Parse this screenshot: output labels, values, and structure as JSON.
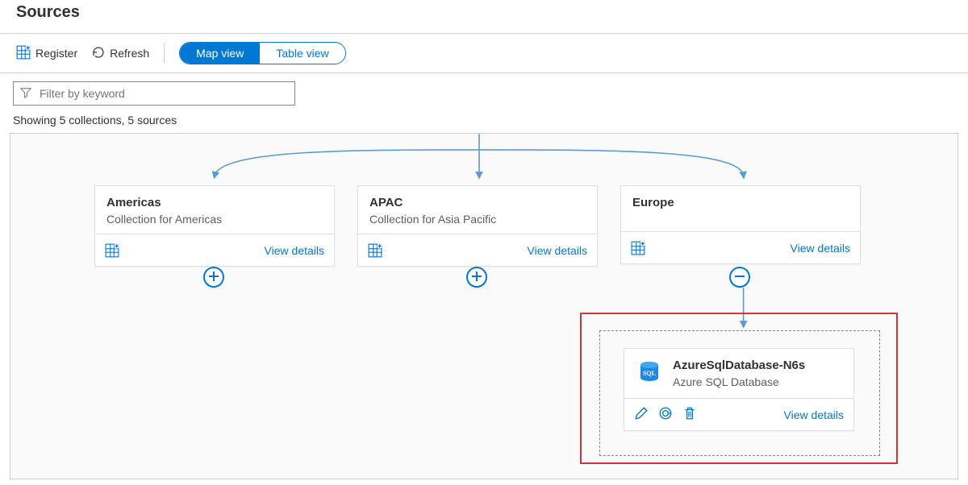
{
  "title": "Sources",
  "toolbar": {
    "register_label": "Register",
    "refresh_label": "Refresh",
    "map_view_label": "Map view",
    "table_view_label": "Table view"
  },
  "filter": {
    "placeholder": "Filter by keyword"
  },
  "count_text": "Showing 5 collections, 5 sources",
  "cards": [
    {
      "title": "Americas",
      "subtitle": "Collection for Americas",
      "link": "View details"
    },
    {
      "title": "APAC",
      "subtitle": "Collection for Asia Pacific",
      "link": "View details"
    },
    {
      "title": "Europe",
      "subtitle": "",
      "link": "View details"
    }
  ],
  "source": {
    "name": "AzureSqlDatabase-N6s",
    "type": "Azure SQL Database",
    "link": "View details"
  }
}
